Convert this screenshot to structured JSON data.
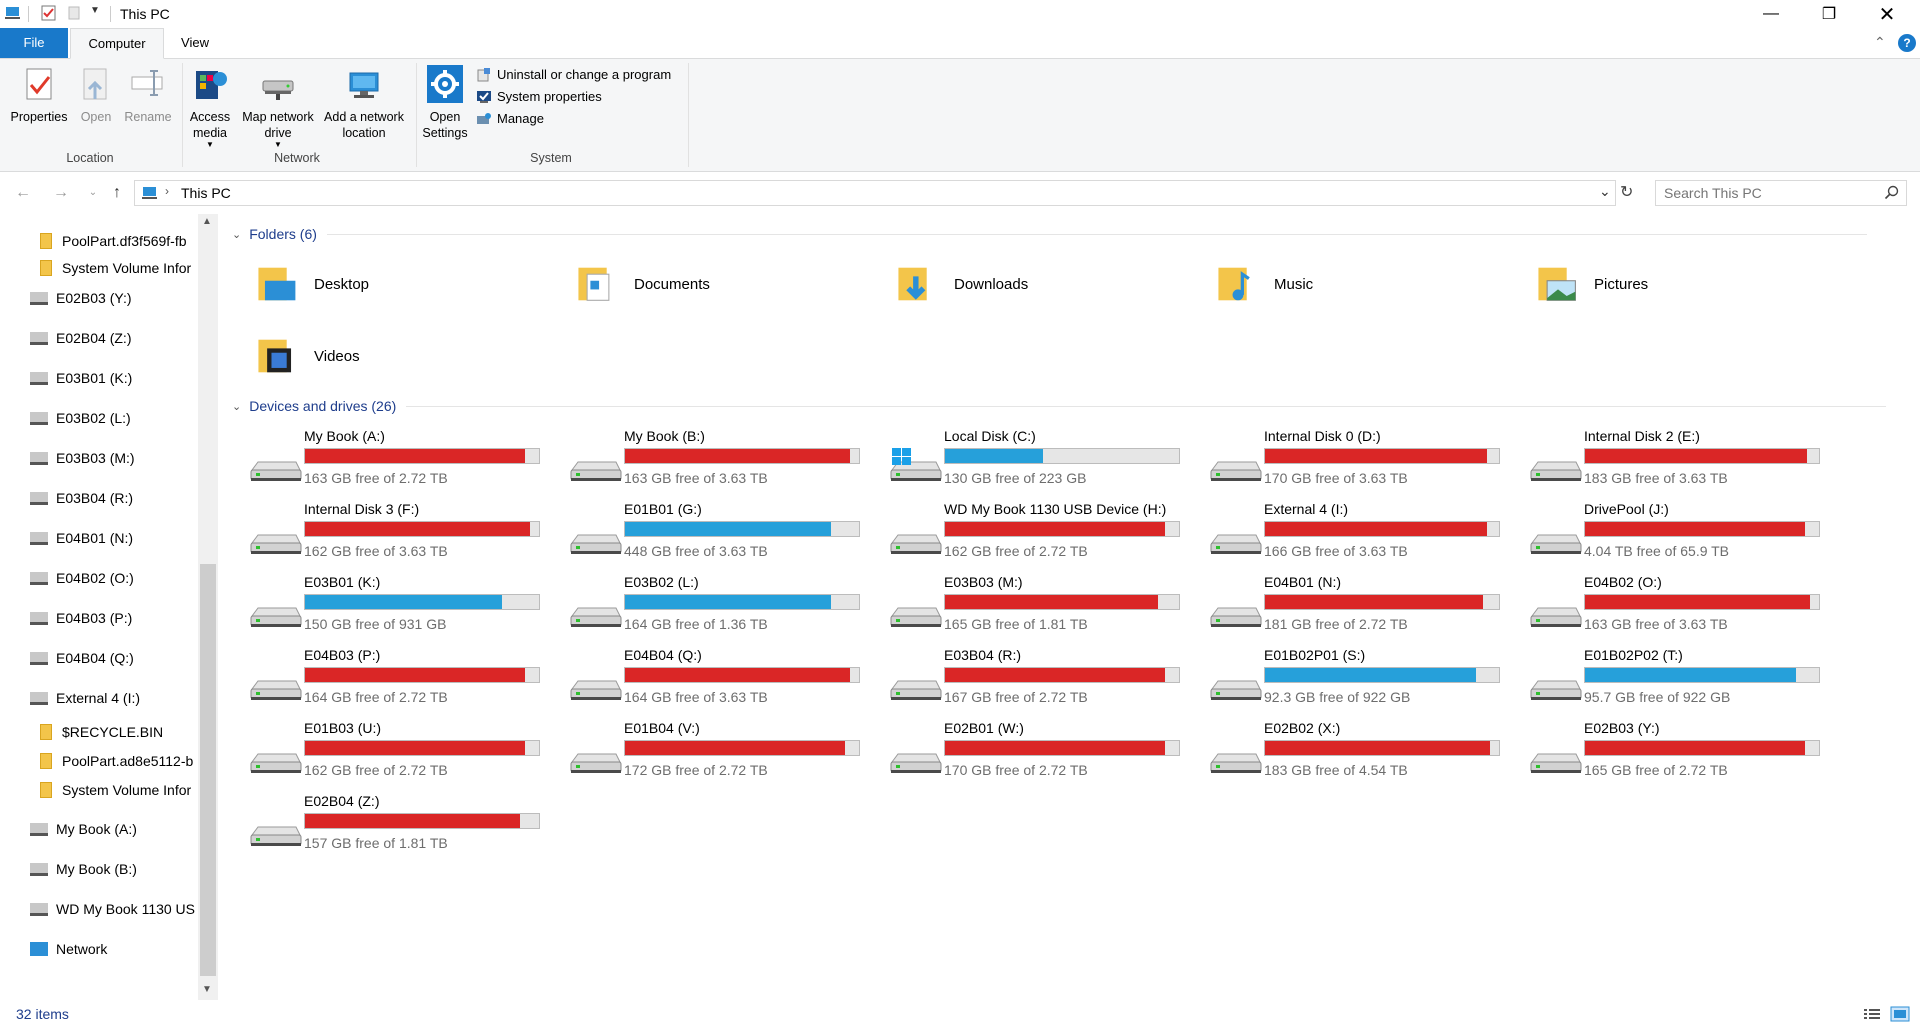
{
  "window": {
    "title": "This PC"
  },
  "ribbon": {
    "tabs": [
      "File",
      "Computer",
      "View"
    ],
    "location": {
      "label": "Location",
      "properties": "Properties",
      "open": "Open",
      "rename": "Rename"
    },
    "network": {
      "label": "Network",
      "access_media": "Access media",
      "map_drive": "Map network drive",
      "add_location": "Add a network location"
    },
    "system": {
      "label": "System",
      "open_settings": "Open Settings",
      "uninstall": "Uninstall or change a program",
      "system_properties": "System properties",
      "manage": "Manage"
    }
  },
  "address": {
    "path": "This PC",
    "search_placeholder": "Search This PC"
  },
  "sidebar": {
    "items": [
      {
        "label": "PoolPart.df3f569f-fb",
        "type": "folder"
      },
      {
        "label": "System Volume Infor",
        "type": "folder"
      },
      {
        "label": "E02B03 (Y:)",
        "type": "drive"
      },
      {
        "label": "E02B04 (Z:)",
        "type": "drive"
      },
      {
        "label": "E03B01 (K:)",
        "type": "drive"
      },
      {
        "label": "E03B02 (L:)",
        "type": "drive"
      },
      {
        "label": "E03B03 (M:)",
        "type": "drive"
      },
      {
        "label": "E03B04 (R:)",
        "type": "drive"
      },
      {
        "label": "E04B01 (N:)",
        "type": "drive"
      },
      {
        "label": "E04B02 (O:)",
        "type": "drive"
      },
      {
        "label": "E04B03 (P:)",
        "type": "drive"
      },
      {
        "label": "E04B04 (Q:)",
        "type": "drive"
      },
      {
        "label": "External 4 (I:)",
        "type": "drive"
      },
      {
        "label": "$RECYCLE.BIN",
        "type": "folder"
      },
      {
        "label": "PoolPart.ad8e5112-b",
        "type": "folder"
      },
      {
        "label": "System Volume Infor",
        "type": "folder"
      },
      {
        "label": "My Book (A:)",
        "type": "drive"
      },
      {
        "label": "My Book (B:)",
        "type": "drive"
      },
      {
        "label": "WD My Book 1130 US",
        "type": "drive"
      },
      {
        "label": "Network",
        "type": "network"
      }
    ]
  },
  "folders": {
    "header": "Folders (6)",
    "items": [
      "Desktop",
      "Documents",
      "Downloads",
      "Music",
      "Pictures",
      "Videos"
    ]
  },
  "drives": {
    "header": "Devices and drives (26)",
    "colors": {
      "full": "#da2626",
      "normal": "#26a0da"
    },
    "items": [
      {
        "name": "My Book (A:)",
        "free": "163 GB free of 2.72 TB",
        "used_fraction": 0.94,
        "full": true
      },
      {
        "name": "My Book (B:)",
        "free": "163 GB free of 3.63 TB",
        "used_fraction": 0.96,
        "full": true
      },
      {
        "name": "Local Disk (C:)",
        "free": "130 GB free of 223 GB",
        "used_fraction": 0.42,
        "full": false,
        "windows": true
      },
      {
        "name": "Internal Disk 0 (D:)",
        "free": "170 GB free of 3.63 TB",
        "used_fraction": 0.95,
        "full": true
      },
      {
        "name": "Internal Disk 2 (E:)",
        "free": "183 GB free of 3.63 TB",
        "used_fraction": 0.95,
        "full": true
      },
      {
        "name": "Internal Disk 3 (F:)",
        "free": "162 GB free of 3.63 TB",
        "used_fraction": 0.96,
        "full": true
      },
      {
        "name": "E01B01 (G:)",
        "free": "448 GB free of 3.63 TB",
        "used_fraction": 0.88,
        "full": false
      },
      {
        "name": "WD My Book 1130 USB Device (H:)",
        "free": "162 GB free of 2.72 TB",
        "used_fraction": 0.94,
        "full": true
      },
      {
        "name": "External 4 (I:)",
        "free": "166 GB free of 3.63 TB",
        "used_fraction": 0.95,
        "full": true
      },
      {
        "name": "DrivePool (J:)",
        "free": "4.04 TB free of 65.9 TB",
        "used_fraction": 0.94,
        "full": true
      },
      {
        "name": "E03B01 (K:)",
        "free": "150 GB free of 931 GB",
        "used_fraction": 0.84,
        "full": false
      },
      {
        "name": "E03B02 (L:)",
        "free": "164 GB free of 1.36 TB",
        "used_fraction": 0.88,
        "full": false
      },
      {
        "name": "E03B03 (M:)",
        "free": "165 GB free of 1.81 TB",
        "used_fraction": 0.91,
        "full": true
      },
      {
        "name": "E04B01 (N:)",
        "free": "181 GB free of 2.72 TB",
        "used_fraction": 0.93,
        "full": true
      },
      {
        "name": "E04B02 (O:)",
        "free": "163 GB free of 3.63 TB",
        "used_fraction": 0.96,
        "full": true
      },
      {
        "name": "E04B03 (P:)",
        "free": "164 GB free of 2.72 TB",
        "used_fraction": 0.94,
        "full": true
      },
      {
        "name": "E04B04 (Q:)",
        "free": "164 GB free of 3.63 TB",
        "used_fraction": 0.96,
        "full": true
      },
      {
        "name": "E03B04 (R:)",
        "free": "167 GB free of 2.72 TB",
        "used_fraction": 0.94,
        "full": true
      },
      {
        "name": "E01B02P01 (S:)",
        "free": "92.3 GB free of 922 GB",
        "used_fraction": 0.9,
        "full": false
      },
      {
        "name": "E01B02P02 (T:)",
        "free": "95.7 GB free of 922 GB",
        "used_fraction": 0.9,
        "full": false
      },
      {
        "name": "E01B03 (U:)",
        "free": "162 GB free of 2.72 TB",
        "used_fraction": 0.94,
        "full": true
      },
      {
        "name": "E01B04 (V:)",
        "free": "172 GB free of 2.72 TB",
        "used_fraction": 0.94,
        "full": true
      },
      {
        "name": "E02B01 (W:)",
        "free": "170 GB free of 2.72 TB",
        "used_fraction": 0.94,
        "full": true
      },
      {
        "name": "E02B02 (X:)",
        "free": "183 GB free of 4.54 TB",
        "used_fraction": 0.96,
        "full": true
      },
      {
        "name": "E02B03 (Y:)",
        "free": "165 GB free of 2.72 TB",
        "used_fraction": 0.94,
        "full": true
      },
      {
        "name": "E02B04 (Z:)",
        "free": "157 GB free of 1.81 TB",
        "used_fraction": 0.92,
        "full": true
      }
    ]
  },
  "status": {
    "items_count": "32 items"
  }
}
